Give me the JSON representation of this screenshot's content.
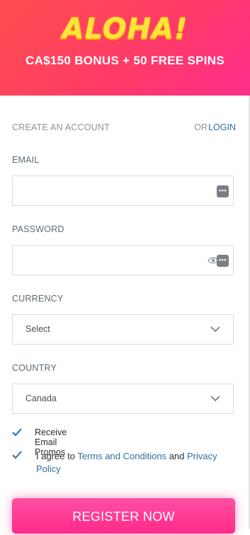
{
  "hero": {
    "title": "ALOHA!",
    "subtitle": "CA$150 BONUS + 50 FREE SPINS"
  },
  "header": {
    "create_account": "CREATE AN ACCOUNT",
    "or": "OR",
    "login": "LOGIN"
  },
  "fields": {
    "email_label": "EMAIL",
    "email_value": "",
    "password_label": "PASSWORD",
    "password_value": "",
    "currency_label": "CURRENCY",
    "currency_selected": "Select",
    "country_label": "COUNTRY",
    "country_selected": "Canada"
  },
  "checks": {
    "promos_label": "Receive Email Promos",
    "promos_checked": true,
    "agree_prefix": "I agree to",
    "terms_link": "Terms and Conditions",
    "agree_and": "and",
    "privacy_link": "Privacy Policy",
    "agree_checked": true
  },
  "register_label": "REGISTER NOW",
  "icons": {
    "key": "key-icon",
    "eye": "eye-icon",
    "chevron": "chevron-down-icon",
    "check": "check-icon"
  },
  "colors": {
    "hero_start": "#ff4f4f",
    "hero_end": "#ff2f8a",
    "title_yellow": "#ffe53a",
    "link_blue": "#2e6fa3",
    "button_pink": "#ff2a8a"
  }
}
